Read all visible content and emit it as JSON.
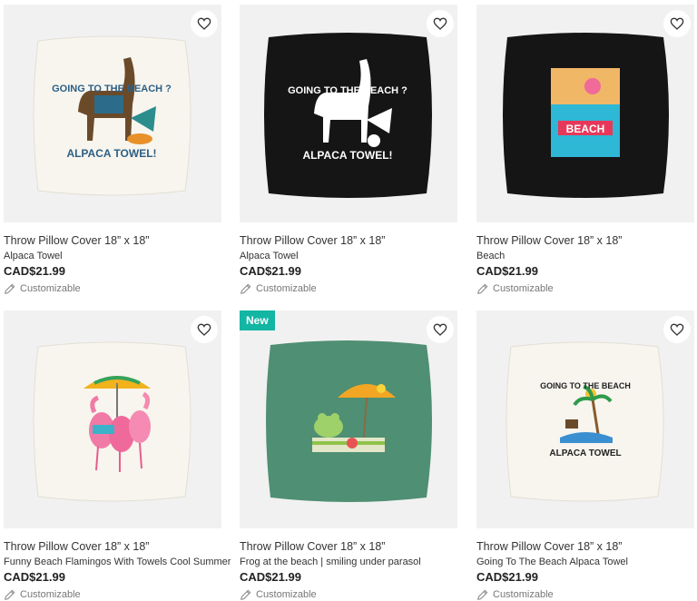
{
  "products": [
    {
      "title": "Throw Pillow Cover 18” x 18”",
      "design": "Alpaca Towel",
      "price": "CAD$21.99",
      "customizable": "Customizable",
      "badge": "",
      "art": {
        "heading": "GOING TO THE BEACH ?",
        "footer": "ALPACA TOWEL!"
      }
    },
    {
      "title": "Throw Pillow Cover 18” x 18”",
      "design": "Alpaca Towel",
      "price": "CAD$21.99",
      "customizable": "Customizable",
      "badge": "",
      "art": {
        "heading": "GOING TO THE BEACH ?",
        "footer": "ALPACA TOWEL!"
      }
    },
    {
      "title": "Throw Pillow Cover 18” x 18”",
      "design": "Beach",
      "price": "CAD$21.99",
      "customizable": "Customizable",
      "badge": "",
      "art": {
        "heading": "",
        "footer": "BEACH"
      }
    },
    {
      "title": "Throw Pillow Cover 18” x 18”",
      "design": "Funny Beach Flamingos With Towels Cool Summer",
      "price": "CAD$21.99",
      "customizable": "Customizable",
      "badge": "",
      "art": {
        "heading": "",
        "footer": ""
      }
    },
    {
      "title": "Throw Pillow Cover 18” x 18”",
      "design": "Frog at the beach | smiling under parasol",
      "price": "CAD$21.99",
      "customizable": "Customizable",
      "badge": "New",
      "art": {
        "heading": "",
        "footer": ""
      }
    },
    {
      "title": "Throw Pillow Cover 18” x 18”",
      "design": "Going To The Beach Alpaca Towel",
      "price": "CAD$21.99",
      "customizable": "Customizable",
      "badge": "",
      "art": {
        "heading": "GOING TO THE BEACH",
        "footer": "ALPACA TOWEL"
      }
    }
  ],
  "colors": {
    "badge": "#13b5a3",
    "pillow_white": "#f7f5ee",
    "pillow_black": "#151515",
    "pillow_green": "#4f8f73"
  },
  "icons": {
    "favorite": "heart-icon",
    "customize": "pencil-icon"
  }
}
